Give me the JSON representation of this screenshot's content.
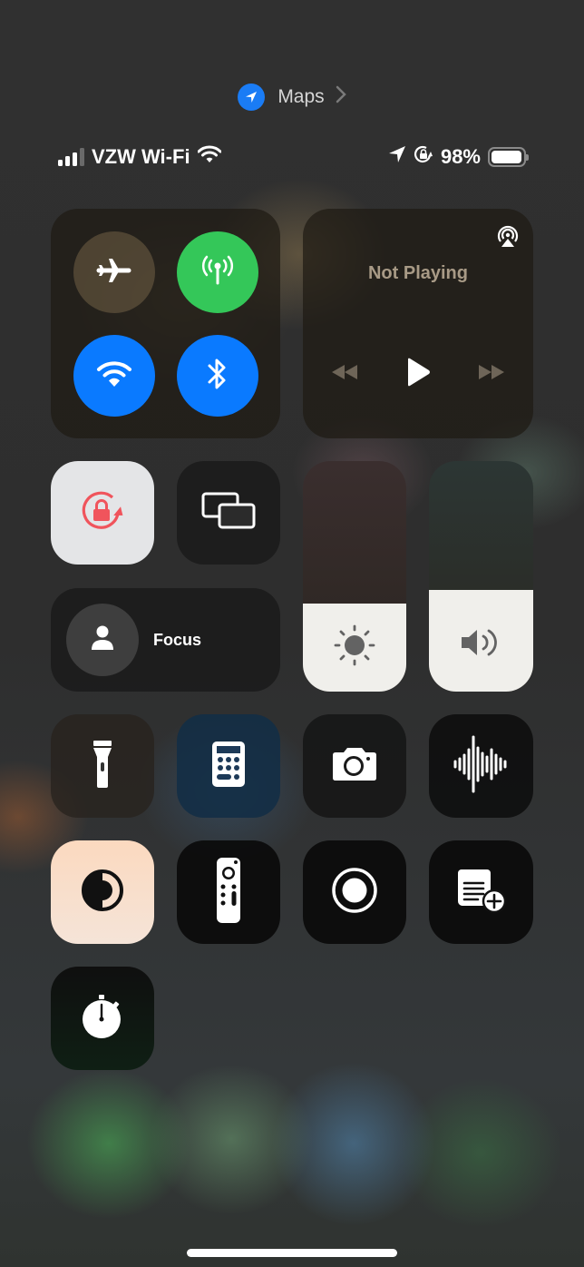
{
  "app_indicator": {
    "app_name": "Maps",
    "icon": "location-arrow-icon",
    "accent": "#1a7cf5"
  },
  "status_bar": {
    "carrier": "VZW Wi-Fi",
    "signal_bars": 3,
    "signal_bars_total": 4,
    "battery_percent": "98%",
    "battery_level": 0.98,
    "icons": [
      "signal-icon",
      "wifi-icon",
      "location-icon",
      "orientation-lock-icon",
      "battery-icon"
    ]
  },
  "connectivity": {
    "airplane_mode": {
      "label": "Airplane Mode",
      "on": false,
      "icon": "airplane-icon"
    },
    "cellular": {
      "label": "Cellular Data",
      "on": true,
      "icon": "antenna-icon",
      "color": "#34c759"
    },
    "wifi": {
      "label": "Wi-Fi",
      "on": true,
      "icon": "wifi-icon",
      "color": "#0a7aff"
    },
    "bluetooth": {
      "label": "Bluetooth",
      "on": true,
      "icon": "bluetooth-icon",
      "color": "#0a7aff"
    }
  },
  "media": {
    "title": "Not Playing",
    "icons": [
      "airplay-icon",
      "rewind-icon",
      "play-icon",
      "fast-forward-icon"
    ]
  },
  "toggles": {
    "orientation_lock": {
      "label": "Orientation Lock",
      "on": true,
      "color": "#f0545c"
    },
    "screen_mirroring": {
      "label": "Screen Mirroring"
    }
  },
  "focus": {
    "label": "Focus"
  },
  "sliders": {
    "brightness": {
      "label": "Brightness",
      "level": 0.38
    },
    "volume": {
      "label": "Volume",
      "level": 0.44
    }
  },
  "shortcuts": [
    {
      "name": "flashlight",
      "icon": "flashlight-icon"
    },
    {
      "name": "calculator",
      "icon": "calculator-icon"
    },
    {
      "name": "camera",
      "icon": "camera-icon"
    },
    {
      "name": "voice-memos",
      "icon": "waveform-icon"
    },
    {
      "name": "dark-mode",
      "icon": "dark-mode-icon",
      "on": true
    },
    {
      "name": "apple-tv-remote",
      "icon": "remote-icon"
    },
    {
      "name": "screen-recording",
      "icon": "record-icon"
    },
    {
      "name": "quick-note",
      "icon": "quick-note-icon"
    },
    {
      "name": "stopwatch",
      "icon": "stopwatch-icon"
    }
  ]
}
